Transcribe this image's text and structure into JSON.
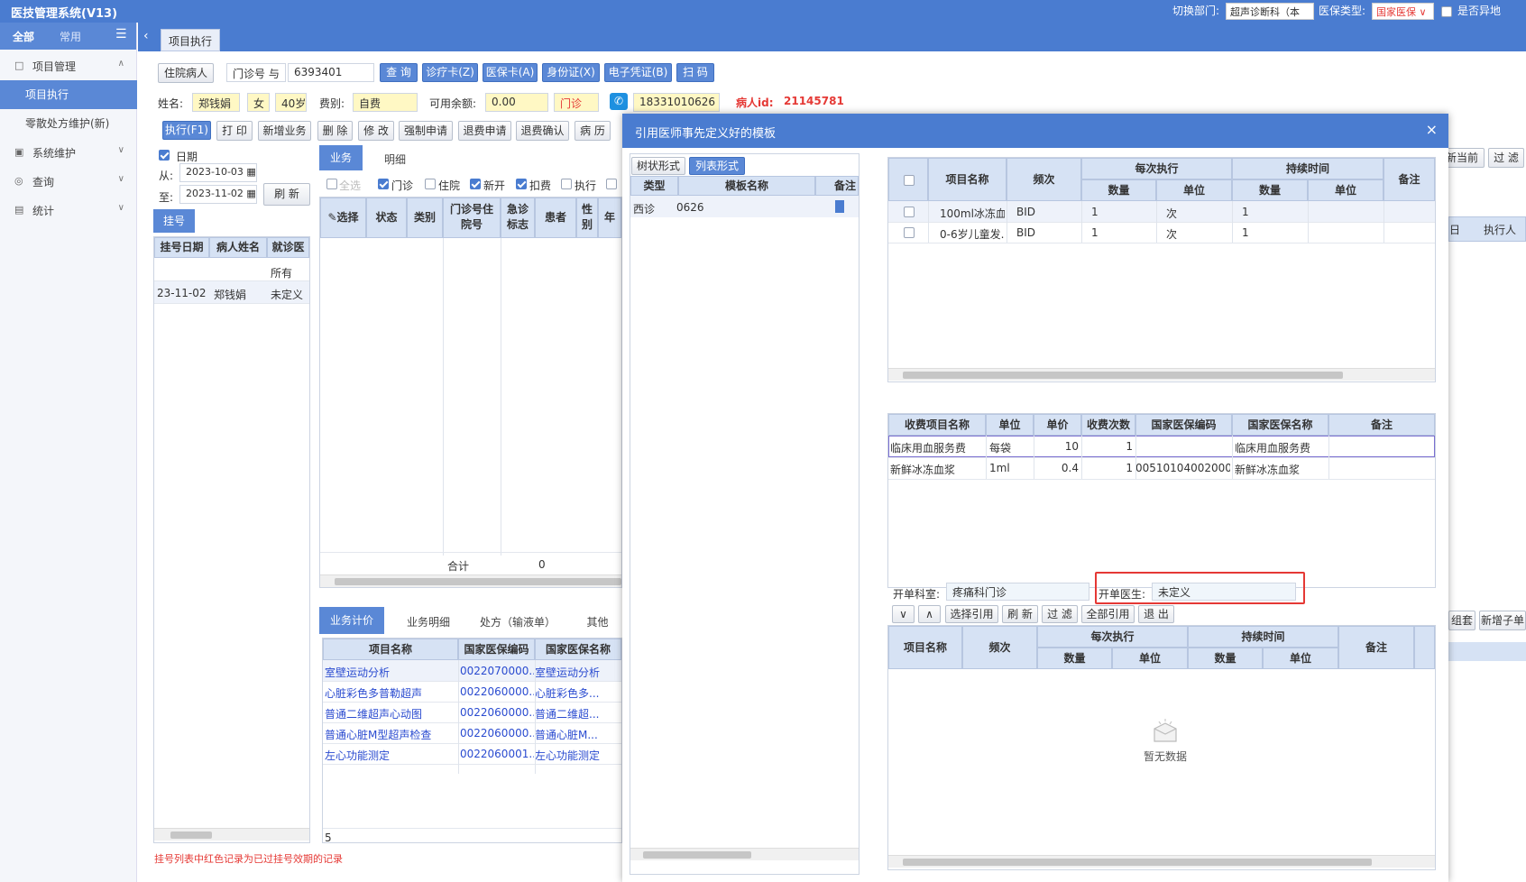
{
  "app": {
    "title": "医技管理系统(V13)",
    "dept_label": "切换部门:",
    "dept_value": "超声诊断科（本",
    "ins_label": "医保类型:",
    "ins_value": "国家医保",
    "remote_label": "是否异地"
  },
  "nav": {
    "tab_all": "全部",
    "tab_common": "常用",
    "groups": [
      {
        "label": "项目管理",
        "icon": "□"
      },
      {
        "label": "系统维护",
        "icon": "▣"
      },
      {
        "label": "查询",
        "icon": "◎"
      },
      {
        "label": "统计",
        "icon": "▤"
      }
    ],
    "subs": [
      "项目执行",
      "零散处方维护(新)"
    ]
  },
  "pagetab": "项目执行",
  "search": {
    "inpatient_btn": "住院病人",
    "mode": "门诊号",
    "mode_value": "6393401",
    "buttons": [
      "查 询",
      "诊疗卡(Z)",
      "医保卡(A)",
      "身份证(X)",
      "电子凭证(B)",
      "扫 码"
    ]
  },
  "patient": {
    "name_label": "姓名:",
    "name": "郑钱娟",
    "gender": "女",
    "age": "40岁",
    "fee_label": "费别:",
    "fee": "自费",
    "balance_label": "可用余额:",
    "balance": "0.00",
    "visit": "门诊",
    "phone": "18331010626",
    "pid_label": "病人id:",
    "pid": "21145781"
  },
  "toolbar": [
    "执行(F1)",
    "打 印",
    "新增业务",
    "删 除",
    "修 改",
    "强制申请",
    "退费申请",
    "退费确认",
    "病 历"
  ],
  "right_btns": [
    "新当前",
    "过 滤"
  ],
  "date": {
    "label": "日期",
    "from_label": "从:",
    "from": "2023-10-03",
    "to_label": "至:",
    "to": "2023-11-02",
    "refresh": "刷 新"
  },
  "reg": {
    "tab": "挂号",
    "cols": [
      "挂号日期",
      "病人姓名",
      "就诊医"
    ],
    "filter": "所有",
    "row": [
      "23-11-02",
      "郑钱娟",
      "未定义"
    ],
    "note": "挂号列表中红色记录为已过挂号效期的记录"
  },
  "biz": {
    "tab_active": "业务",
    "tab_other": "明细",
    "filters": [
      "全选",
      "门诊",
      "住院",
      "新开",
      "扣费",
      "执行"
    ],
    "cols": [
      "选择",
      "状态",
      "类别",
      "门诊号住院号",
      "急诊标志",
      "患者",
      "性别",
      "年"
    ],
    "sum_label": "合计",
    "sum_value": "0"
  },
  "charge": {
    "tabs": [
      "业务计价",
      "业务明细",
      "处方（输液单）",
      "其他"
    ],
    "cols": [
      "项目名称",
      "国家医保编码",
      "国家医保名称"
    ],
    "rows": [
      [
        "室壁运动分析",
        "0022070000...",
        "室壁运动分析"
      ],
      [
        "心脏彩色多普勒超声",
        "0022060000...",
        "心脏彩色多..."
      ],
      [
        "普通二维超声心动图",
        "0022060000...",
        "普通二维超..."
      ],
      [
        "普通心脏M型超声检查",
        "0022060000...",
        "普通心脏M..."
      ],
      [
        "左心功能测定",
        "0022060001...",
        "左心功能测定"
      ]
    ],
    "footer": "5"
  },
  "right_hidden": {
    "col1": "日",
    "col2": "执行人",
    "btn1": "组套",
    "btn2": "新增子单"
  },
  "modal": {
    "title": "引用医师事先定义好的模板",
    "close": "×",
    "view_tabs": [
      "树状形式",
      "列表形式"
    ],
    "tpl_cols": [
      "类型",
      "模板名称",
      "备注"
    ],
    "tpl_row": [
      "西诊",
      "0626"
    ],
    "items_cols": {
      "name": "项目名称",
      "freq": "频次",
      "each": "每次执行",
      "dur": "持续时间",
      "qty": "数量",
      "unit": "单位",
      "note": "备注"
    },
    "items": [
      [
        "100ml冰冻血...",
        "BID",
        "1",
        "次",
        "1"
      ],
      [
        "0-6岁儿童发...",
        "BID",
        "1",
        "次",
        "1"
      ]
    ],
    "fee_cols": [
      "收费项目名称",
      "单位",
      "单价",
      "收费次数",
      "国家医保编码",
      "国家医保名称",
      "备注"
    ],
    "fees": [
      [
        "临床用血服务费",
        "每袋",
        "10",
        "1",
        "",
        "临床用血服务费"
      ],
      [
        "新鲜冰冻血浆",
        "1ml",
        "0.4",
        "1",
        "00510104002000...",
        "新鲜冰冻血浆"
      ]
    ],
    "dept_label": "开单科室:",
    "dept": "疼痛科门诊",
    "doctor_label": "开单医生:",
    "doctor": "未定义",
    "actions": [
      "选择引用",
      "刷 新",
      "过 滤",
      "全部引用",
      "退 出"
    ],
    "empty": "暂无数据"
  },
  "colors": {
    "primary": "#4a7cd0",
    "highlight": "#e53935"
  }
}
